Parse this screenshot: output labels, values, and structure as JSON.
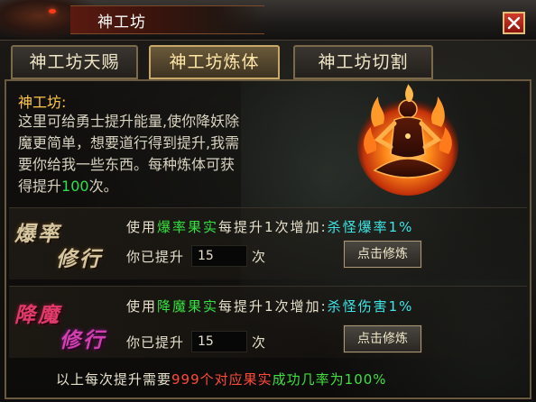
{
  "window": {
    "title": "神工坊",
    "close_icon": "close-x-icon"
  },
  "tabs": [
    {
      "label": "神工坊天赐",
      "active": false
    },
    {
      "label": "神工坊炼体",
      "active": true
    },
    {
      "label": "神工坊切割",
      "active": false
    }
  ],
  "intro": {
    "title": "神工坊:",
    "line1": "这里可给勇士提升能量,使你降妖除",
    "line2": "魔更简单，想要道行得到提升,我需",
    "line3": "要你给我一些东西。每种炼体可获",
    "line4_prefix": "得提升",
    "line4_value": "100",
    "line4_suffix": "次。",
    "emblem_icon": "meditating-figure-flame-icon"
  },
  "sections": [
    {
      "title_a": "爆率",
      "title_b": "修行",
      "use_prefix": "使用",
      "item": "爆率果实",
      "mid": "每提升1次增加:",
      "stat": "杀怪爆率1%",
      "raise_label": "你已提升",
      "raise_value": "15",
      "raise_unit": "次",
      "button": "点击修炼"
    },
    {
      "title_a": "降魔",
      "title_b": "修行",
      "use_prefix": "使用",
      "item": "降魔果实",
      "mid": "每提升1次增加:",
      "stat": "杀怪伤害1%",
      "raise_label": "你已提升",
      "raise_value": "15",
      "raise_unit": "次",
      "button": "点击修炼"
    }
  ],
  "footer": {
    "prefix": "以上每次提升需要",
    "cost": "999个对应果实",
    "success": "成功几率为100%"
  },
  "colors": {
    "gold": "#ffc84a",
    "green": "#2ee04a",
    "cyan": "#3de8e8",
    "red": "#ff4a3a"
  }
}
